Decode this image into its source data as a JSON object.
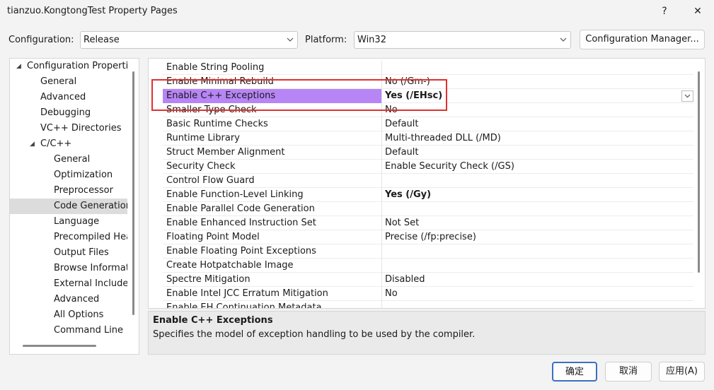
{
  "window": {
    "title": "tianzuo.KongtongTest Property Pages",
    "help_label": "?",
    "close_label": "✕"
  },
  "config_bar": {
    "configuration_label": "Configuration:",
    "configuration_value": "Release",
    "platform_label": "Platform:",
    "platform_value": "Win32",
    "manager_button": "Configuration Manager..."
  },
  "tree": {
    "items": [
      {
        "label": "Configuration Properties",
        "level": 0,
        "expanded": true
      },
      {
        "label": "General",
        "level": 1
      },
      {
        "label": "Advanced",
        "level": 1
      },
      {
        "label": "Debugging",
        "level": 1
      },
      {
        "label": "VC++ Directories",
        "level": 1
      },
      {
        "label": "C/C++",
        "level": 1,
        "expanded": true
      },
      {
        "label": "General",
        "level": 2
      },
      {
        "label": "Optimization",
        "level": 2
      },
      {
        "label": "Preprocessor",
        "level": 2
      },
      {
        "label": "Code Generation",
        "level": 2,
        "selected": true
      },
      {
        "label": "Language",
        "level": 2
      },
      {
        "label": "Precompiled Headers",
        "level": 2
      },
      {
        "label": "Output Files",
        "level": 2
      },
      {
        "label": "Browse Information",
        "level": 2
      },
      {
        "label": "External Includes",
        "level": 2
      },
      {
        "label": "Advanced",
        "level": 2
      },
      {
        "label": "All Options",
        "level": 2
      },
      {
        "label": "Command Line",
        "level": 2
      }
    ]
  },
  "properties": {
    "rows": [
      {
        "name": "Enable String Pooling",
        "value": ""
      },
      {
        "name": "Enable Minimal Rebuild",
        "value": "No (/Gm-)"
      },
      {
        "name": "Enable C++ Exceptions",
        "value": "Yes (/EHsc)",
        "bold": true,
        "selected": true
      },
      {
        "name": "Smaller Type Check",
        "value": "No"
      },
      {
        "name": "Basic Runtime Checks",
        "value": "Default"
      },
      {
        "name": "Runtime Library",
        "value": "Multi-threaded DLL (/MD)"
      },
      {
        "name": "Struct Member Alignment",
        "value": "Default"
      },
      {
        "name": "Security Check",
        "value": "Enable Security Check (/GS)"
      },
      {
        "name": "Control Flow Guard",
        "value": ""
      },
      {
        "name": "Enable Function-Level Linking",
        "value": "Yes (/Gy)",
        "bold": true
      },
      {
        "name": "Enable Parallel Code Generation",
        "value": ""
      },
      {
        "name": "Enable Enhanced Instruction Set",
        "value": "Not Set"
      },
      {
        "name": "Floating Point Model",
        "value": "Precise (/fp:precise)"
      },
      {
        "name": "Enable Floating Point Exceptions",
        "value": ""
      },
      {
        "name": "Create Hotpatchable Image",
        "value": ""
      },
      {
        "name": "Spectre Mitigation",
        "value": "Disabled"
      },
      {
        "name": "Enable Intel JCC Erratum Mitigation",
        "value": "No"
      },
      {
        "name": "Enable EH Continuation Metadata",
        "value": ""
      }
    ]
  },
  "description": {
    "title": "Enable C++ Exceptions",
    "text": "Specifies the model of exception handling to be used by the compiler."
  },
  "buttons": {
    "ok": "确定",
    "cancel": "取消",
    "apply": "应用(A)"
  },
  "colors": {
    "selected_row": "#b785f5",
    "highlight_box": "#e03030",
    "tree_selected": "#dcdcdc"
  }
}
